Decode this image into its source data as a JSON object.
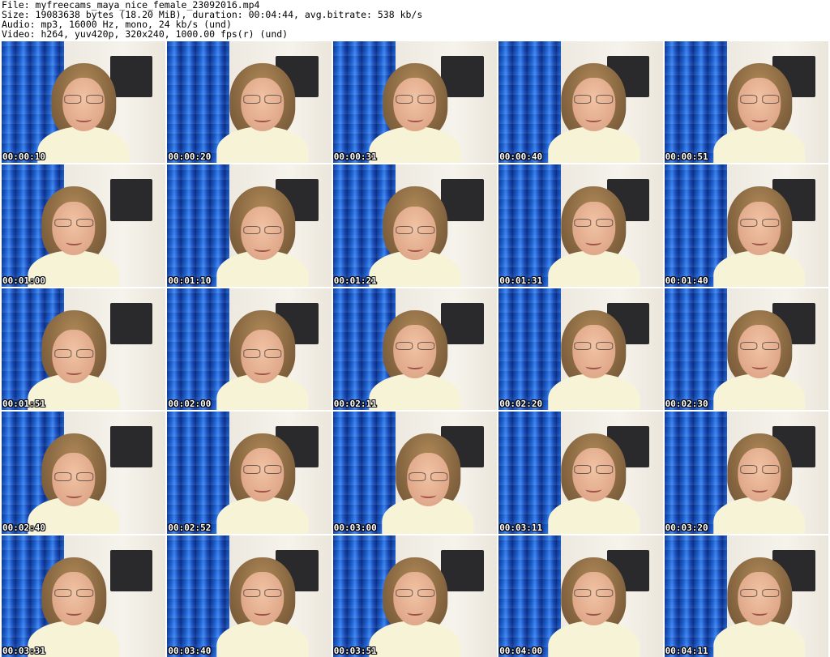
{
  "header": {
    "file_line": "File: myfreecams_maya_nice_female_23092016.mp4",
    "size_line": "Size: 19083638 bytes (18.20 MiB), duration: 00:04:44, avg.bitrate: 538 kb/s",
    "audio_line": "Audio: mp3, 16000 Hz, mono, 24 kb/s (und)",
    "video_line": "Video: h264, yuv420p, 320x240, 1000.00 fps(r) (und)"
  },
  "frames": [
    {
      "timestamp": "00:00:10"
    },
    {
      "timestamp": "00:00:20"
    },
    {
      "timestamp": "00:00:31"
    },
    {
      "timestamp": "00:00:40"
    },
    {
      "timestamp": "00:00:51"
    },
    {
      "timestamp": "00:01:00"
    },
    {
      "timestamp": "00:01:10"
    },
    {
      "timestamp": "00:01:21"
    },
    {
      "timestamp": "00:01:31"
    },
    {
      "timestamp": "00:01:40"
    },
    {
      "timestamp": "00:01:51"
    },
    {
      "timestamp": "00:02:00"
    },
    {
      "timestamp": "00:02:11"
    },
    {
      "timestamp": "00:02:20"
    },
    {
      "timestamp": "00:02:30"
    },
    {
      "timestamp": "00:02:40"
    },
    {
      "timestamp": "00:02:52"
    },
    {
      "timestamp": "00:03:00"
    },
    {
      "timestamp": "00:03:11"
    },
    {
      "timestamp": "00:03:20"
    },
    {
      "timestamp": "00:03:31"
    },
    {
      "timestamp": "00:03:40"
    },
    {
      "timestamp": "00:03:51"
    },
    {
      "timestamp": "00:04:00"
    },
    {
      "timestamp": "00:04:11"
    }
  ]
}
